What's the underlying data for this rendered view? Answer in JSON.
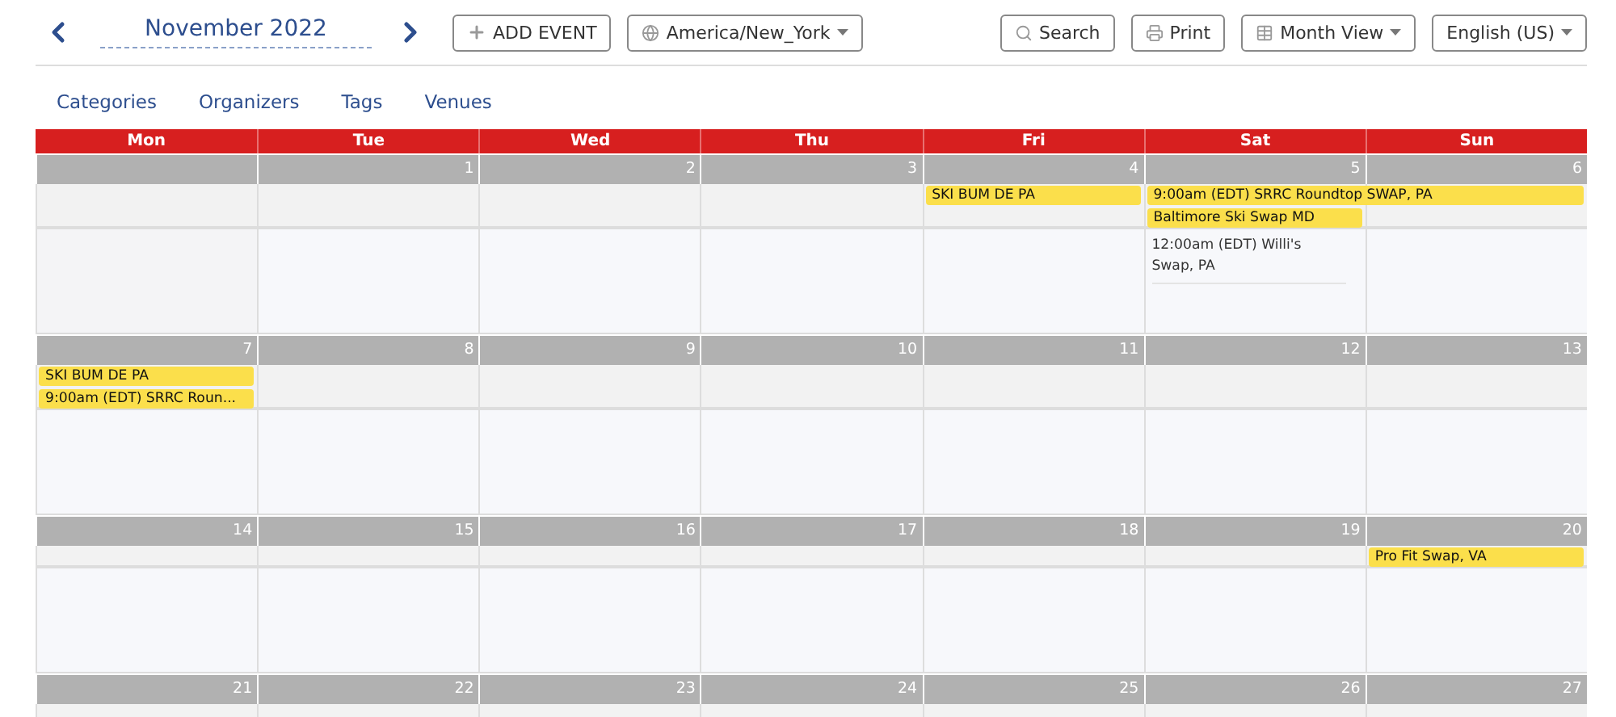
{
  "header": {
    "month_title": "November 2022",
    "add_event": "ADD EVENT",
    "timezone": "America/New_York",
    "search": "Search",
    "print": "Print",
    "view": "Month View",
    "language": "English (US)"
  },
  "filters": [
    {
      "label": "Categories"
    },
    {
      "label": "Organizers"
    },
    {
      "label": "Tags"
    },
    {
      "label": "Venues"
    }
  ],
  "weekdays": [
    "Mon",
    "Tue",
    "Wed",
    "Thu",
    "Fri",
    "Sat",
    "Sun"
  ],
  "weeks": [
    {
      "days": [
        {
          "number": "1"
        },
        {
          "number": "2"
        },
        {
          "number": "3"
        },
        {
          "number": "4",
          "events": [
            {
              "kind": "bar",
              "title": "SKI BUM DE PA"
            }
          ]
        },
        {
          "number": "5",
          "events": [
            {
              "kind": "bar",
              "title": "9:00am (EDT) SRRC Roundtop SWAP, PA",
              "spans_next_day": true
            },
            {
              "kind": "bar",
              "title": "Baltimore Ski Swap MD"
            },
            {
              "kind": "item",
              "title": "12:00am (EDT) Willi's Swap, PA"
            }
          ]
        },
        {
          "number": "6"
        }
      ]
    },
    {
      "days": [
        {
          "number": "7",
          "events": [
            {
              "kind": "bar",
              "title": "SKI BUM DE PA"
            },
            {
              "kind": "bar",
              "title": "9:00am (EDT) SRRC Roun..."
            }
          ]
        },
        {
          "number": "8"
        },
        {
          "number": "9"
        },
        {
          "number": "10"
        },
        {
          "number": "11"
        },
        {
          "number": "12"
        },
        {
          "number": "13"
        }
      ]
    },
    {
      "days": [
        {
          "number": "14"
        },
        {
          "number": "15"
        },
        {
          "number": "16"
        },
        {
          "number": "17"
        },
        {
          "number": "18"
        },
        {
          "number": "19"
        },
        {
          "number": "20",
          "events": [
            {
              "kind": "bar",
              "title": "Pro Fit Swap, VA"
            }
          ]
        }
      ]
    },
    {
      "days": [
        {
          "number": "21"
        },
        {
          "number": "22"
        },
        {
          "number": "23"
        },
        {
          "number": "24"
        },
        {
          "number": "25"
        },
        {
          "number": "26"
        },
        {
          "number": "27"
        }
      ]
    }
  ]
}
